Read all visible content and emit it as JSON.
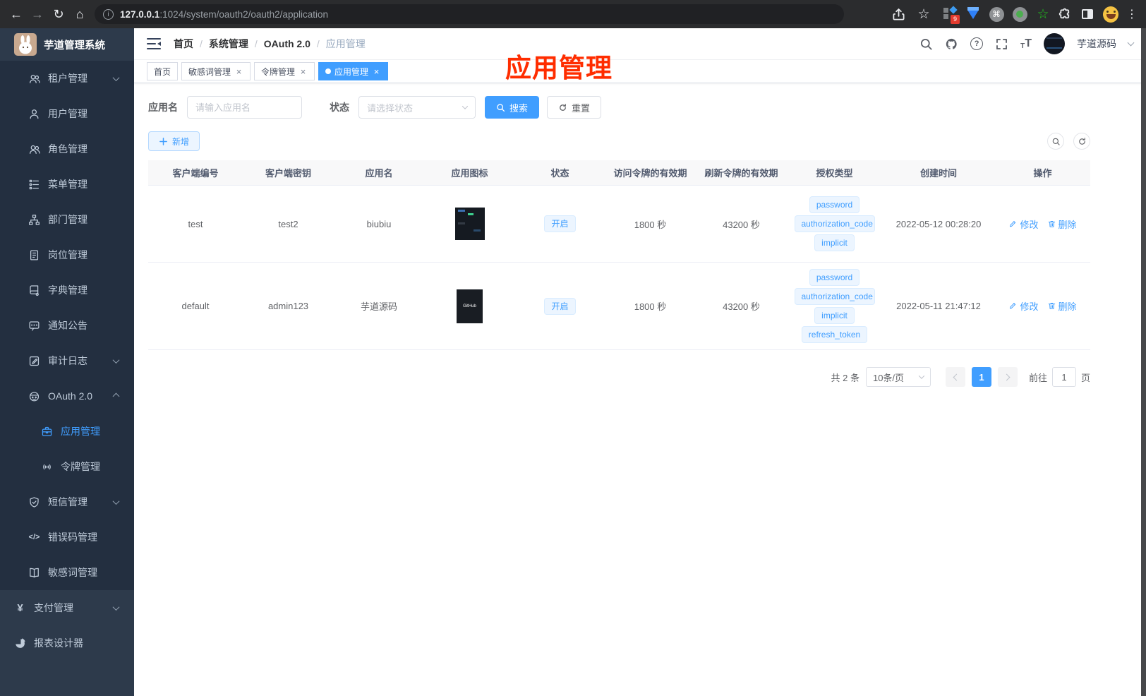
{
  "glyphs": {
    "back": "←",
    "forward": "→",
    "reload": "↻",
    "home": "⌂",
    "info": "i",
    "star": "☆",
    "green_star": "☆",
    "command": "⌘",
    "kebab": "⋮",
    "close": "×",
    "help": "?",
    "font_small": "T",
    "font_large": "T",
    "yen": "¥",
    "code": "</>",
    "slash": "/"
  },
  "browser": {
    "url_host": "127.0.0.1",
    "url_path": ":1024/system/oauth2/oauth2/application",
    "extension_badge": "9"
  },
  "sidebar": {
    "logo_title": "芋道管理系统",
    "items": [
      {
        "label": "租户管理",
        "icon": "users-icon",
        "chevron": "down"
      },
      {
        "label": "用户管理",
        "icon": "user-icon"
      },
      {
        "label": "角色管理",
        "icon": "users-icon"
      },
      {
        "label": "菜单管理",
        "icon": "menu-tree-icon"
      },
      {
        "label": "部门管理",
        "icon": "org-tree-icon"
      },
      {
        "label": "岗位管理",
        "icon": "id-badge-icon"
      },
      {
        "label": "字典管理",
        "icon": "dictionary-icon"
      },
      {
        "label": "通知公告",
        "icon": "chat-bubble-icon"
      },
      {
        "label": "审计日志",
        "icon": "audit-log-icon",
        "chevron": "down"
      },
      {
        "label": "OAuth 2.0",
        "icon": "robot-icon",
        "chevron": "up"
      },
      {
        "label": "应用管理",
        "icon": "briefcase-icon",
        "active": true
      },
      {
        "label": "令牌管理",
        "icon": "signal-icon"
      },
      {
        "label": "短信管理",
        "icon": "shield-check-icon",
        "chevron": "down"
      },
      {
        "label": "错误码管理",
        "icon": "code-icon"
      },
      {
        "label": "敏感词管理",
        "icon": "open-book-icon"
      },
      {
        "label": "支付管理",
        "icon": "yen-icon",
        "chevron": "down"
      },
      {
        "label": "报表设计器",
        "icon": "pie-chart-icon"
      }
    ]
  },
  "navbar": {
    "breadcrumb": [
      "首页",
      "系统管理",
      "OAuth 2.0",
      "应用管理"
    ],
    "user_name": "芋道源码"
  },
  "tabs": [
    {
      "label": "首页",
      "closable": false,
      "active": false
    },
    {
      "label": "敏感词管理",
      "closable": true,
      "active": false
    },
    {
      "label": "令牌管理",
      "closable": true,
      "active": false
    },
    {
      "label": "应用管理",
      "closable": true,
      "active": true
    }
  ],
  "annotation": {
    "text": "应用管理",
    "color": "#ff2d00"
  },
  "filters": {
    "name_label": "应用名",
    "name_placeholder": "请输入应用名",
    "status_label": "状态",
    "status_placeholder": "请选择状态",
    "search_label": "搜索",
    "reset_label": "重置"
  },
  "toolbar": {
    "add_label": "新增"
  },
  "table": {
    "headers": [
      "客户端编号",
      "客户端密钥",
      "应用名",
      "应用图标",
      "状态",
      "访问令牌的有效期",
      "刷新令牌的有效期",
      "授权类型",
      "创建时间",
      "操作"
    ],
    "rows": [
      {
        "client_id": "test",
        "client_secret": "test2",
        "app_name": "biubiu",
        "icon_text": "",
        "status": "开启",
        "access_ttl": "1800 秒",
        "refresh_ttl": "43200 秒",
        "grants": [
          "password",
          "authorization_code",
          "implicit"
        ],
        "created_at": "2022-05-12 00:28:20",
        "edit_label": "修改",
        "delete_label": "删除"
      },
      {
        "client_id": "default",
        "client_secret": "admin123",
        "app_name": "芋道源码",
        "icon_text": "GitHub",
        "status": "开启",
        "access_ttl": "1800 秒",
        "refresh_ttl": "43200 秒",
        "grants": [
          "password",
          "authorization_code",
          "implicit",
          "refresh_token"
        ],
        "created_at": "2022-05-11 21:47:12",
        "edit_label": "修改",
        "delete_label": "删除"
      }
    ]
  },
  "pagination": {
    "total": "共 2 条",
    "page_size": "10条/页",
    "page": "1",
    "goto_label": "前往",
    "goto_value": "1",
    "page_unit": "页"
  },
  "colors": {
    "accent": "#409eff",
    "tag_bg": "#ecf5ff",
    "annotation_red": "#ff2d00",
    "sidebar_bg": "#2d3a4b",
    "submenu_bg": "#232f40"
  }
}
